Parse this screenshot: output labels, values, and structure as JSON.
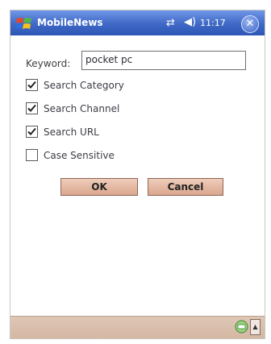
{
  "titlebar": {
    "app_title": "MobileNews",
    "clock": "11:17",
    "close_label": "✕"
  },
  "form": {
    "keyword_label": "Keyword:",
    "keyword_value": "pocket pc",
    "options": [
      {
        "label": "Search Category",
        "checked": true
      },
      {
        "label": "Search Channel",
        "checked": true
      },
      {
        "label": "Search URL",
        "checked": true
      },
      {
        "label": "Case Sensitive",
        "checked": false
      }
    ],
    "ok_label": "OK",
    "cancel_label": "Cancel"
  },
  "bottombar": {
    "sip_arrow": "▲"
  }
}
